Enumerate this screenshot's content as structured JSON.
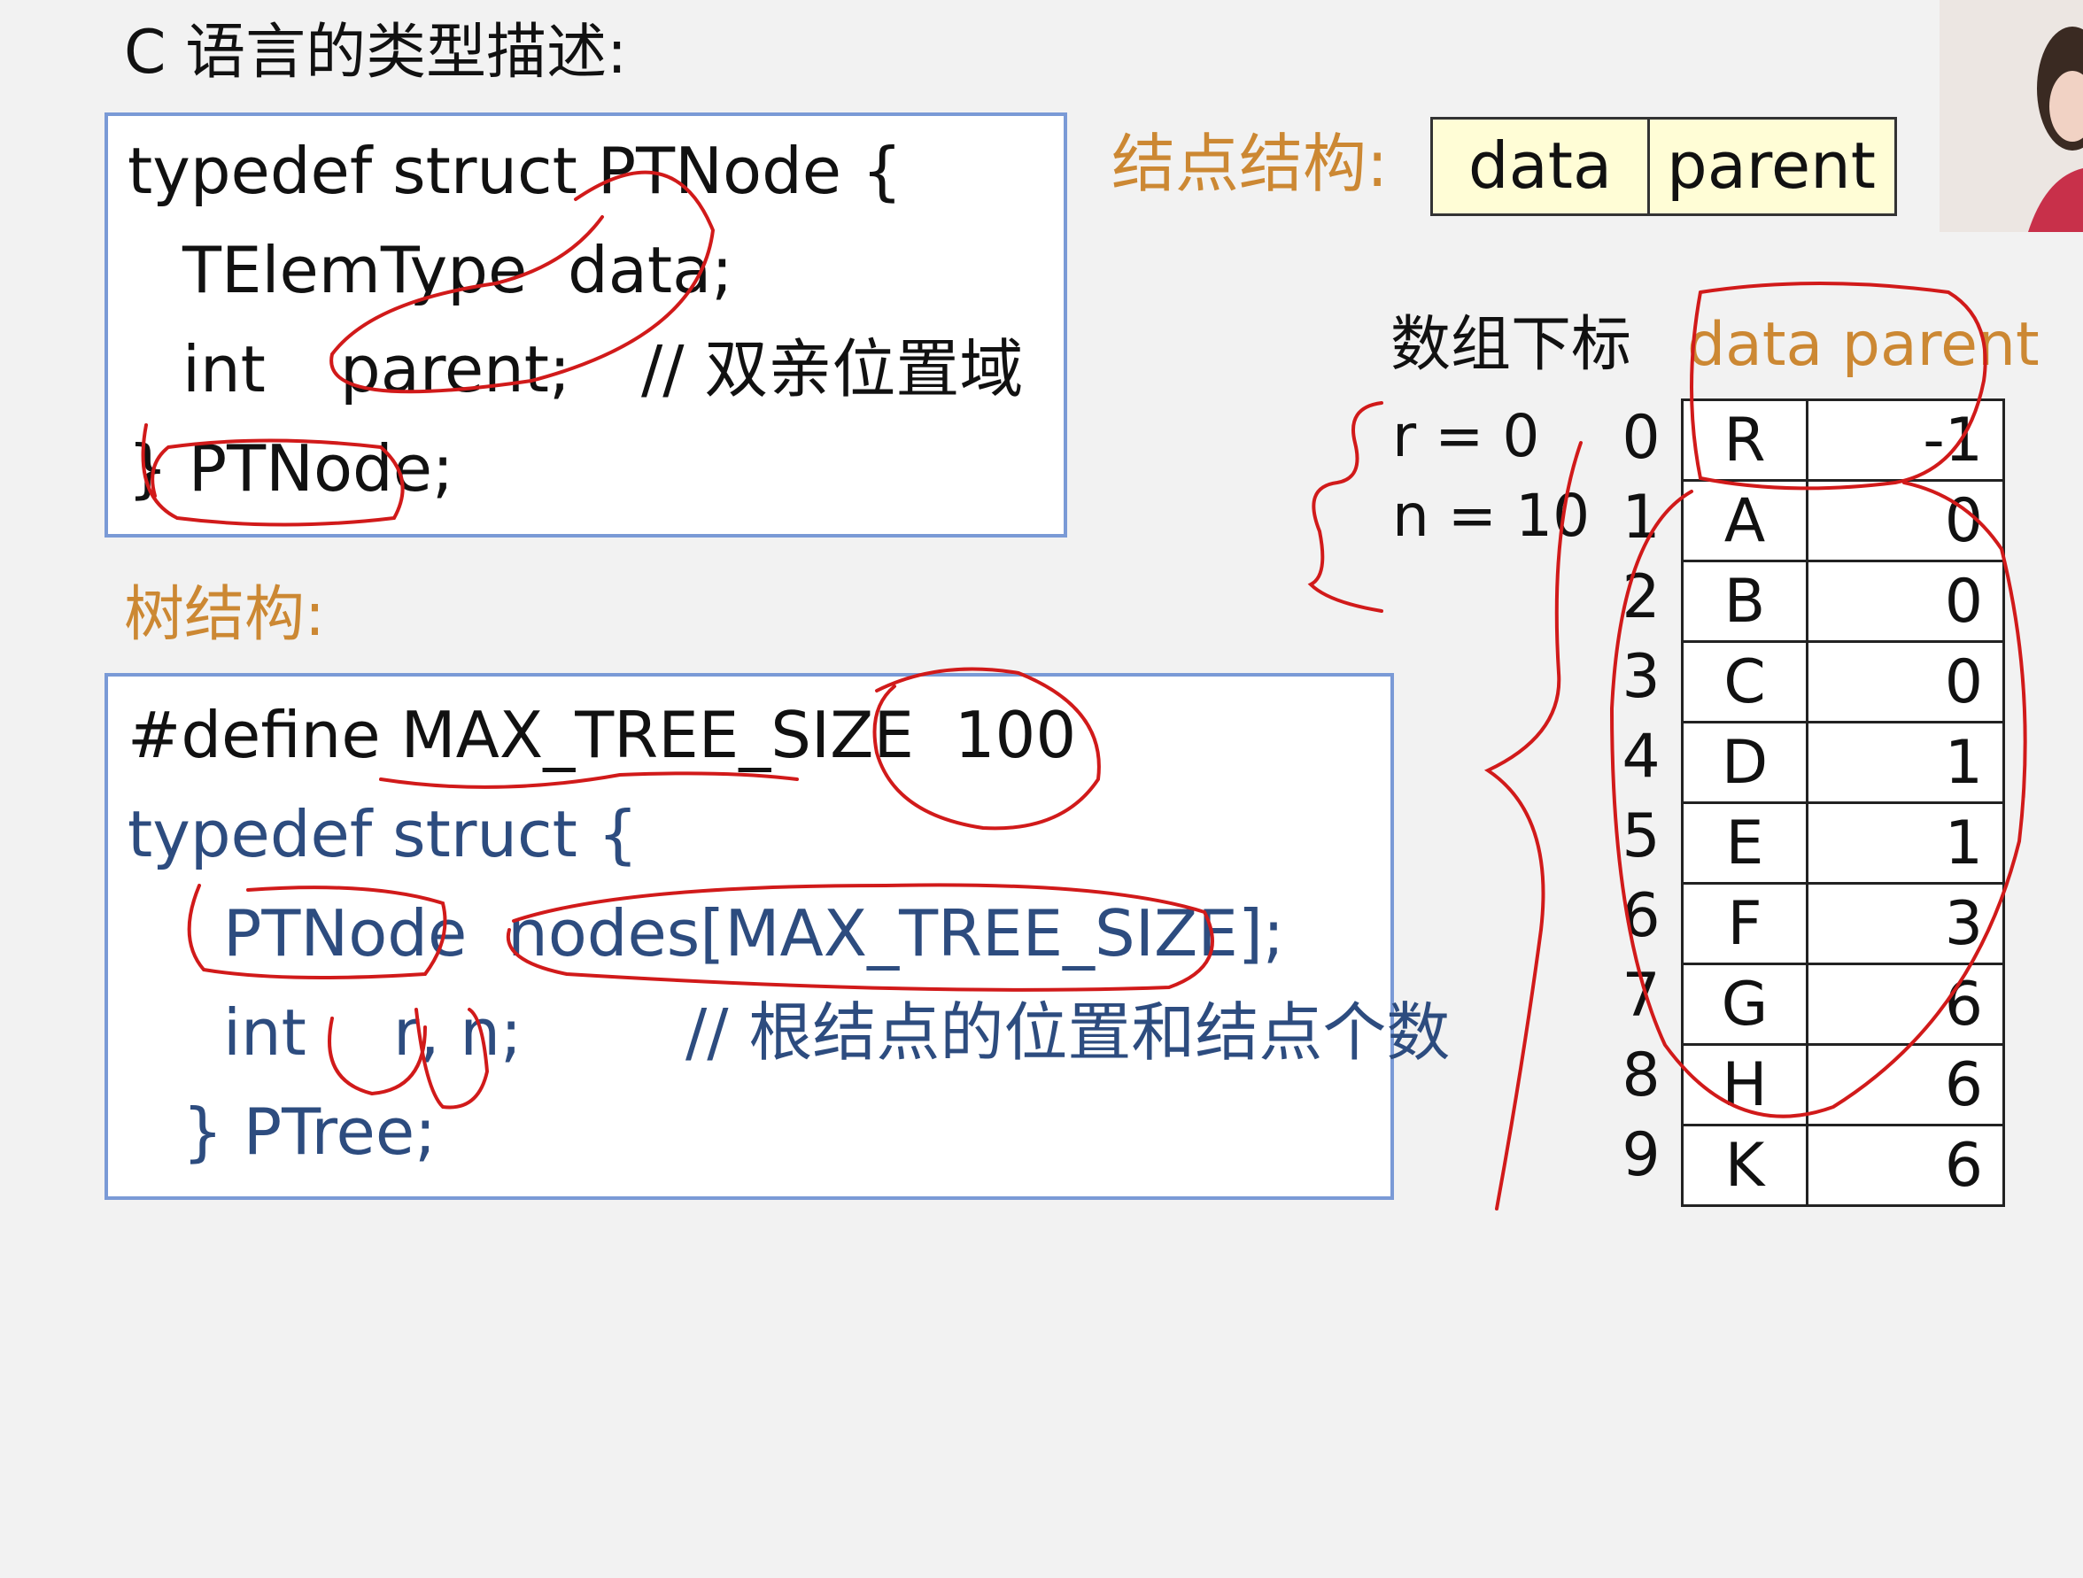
{
  "title": "C 语言的类型描述:",
  "ptnode_code": {
    "line1": "typedef struct PTNode {",
    "line2": "TElemType  data;",
    "line3_kw": "int",
    "line3_var": "parent;",
    "line3_comment": "// 双亲位置域",
    "line4": "} PTNode;"
  },
  "node_structure": {
    "label": "结点结构:",
    "fields": [
      "data",
      "parent"
    ]
  },
  "tree_structure_label": "树结构:",
  "ptree_code": {
    "line1": "#define MAX_TREE_SIZE  100",
    "line2": "typedef struct {",
    "line3": "PTNode  nodes[MAX_TREE_SIZE];",
    "line4_kw": "int",
    "line4_vars": "r, n;",
    "line4_comment": "// 根结点的位置和结点个数",
    "line5": "} PTree;"
  },
  "array": {
    "header_index": "数组下标",
    "header_fields": "data parent",
    "r_label": "r = 0",
    "n_label": "n = 10",
    "rows": [
      {
        "index": "0",
        "data": "R",
        "parent": "-1"
      },
      {
        "index": "1",
        "data": "A",
        "parent": "0"
      },
      {
        "index": "2",
        "data": "B",
        "parent": "0"
      },
      {
        "index": "3",
        "data": "C",
        "parent": "0"
      },
      {
        "index": "4",
        "data": "D",
        "parent": "1"
      },
      {
        "index": "5",
        "data": "E",
        "parent": "1"
      },
      {
        "index": "6",
        "data": "F",
        "parent": "3"
      },
      {
        "index": "7",
        "data": "G",
        "parent": "6"
      },
      {
        "index": "8",
        "data": "H",
        "parent": "6"
      },
      {
        "index": "9",
        "data": "K",
        "parent": "6"
      }
    ]
  },
  "colors": {
    "accent_orange": "#cc8833",
    "code_blue": "#2d4c7f",
    "box_border": "#7a9ad6",
    "struct_fill": "#fffdd6",
    "ink_red": "#d11a1a"
  }
}
